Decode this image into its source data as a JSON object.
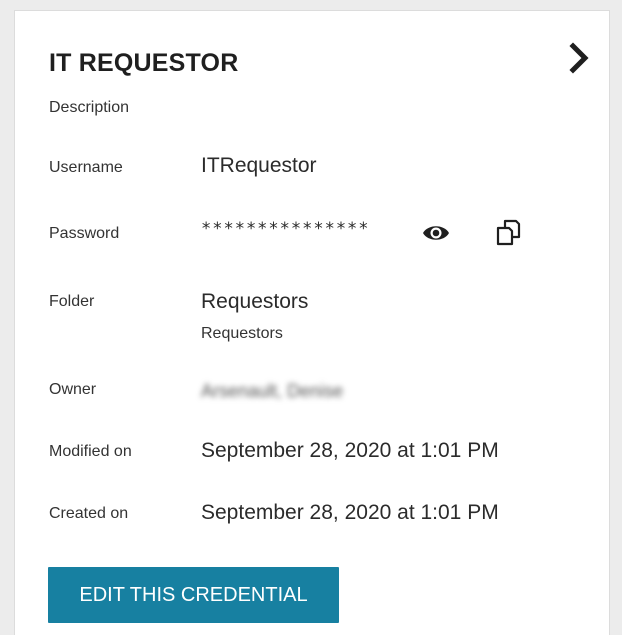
{
  "credential": {
    "title": "IT REQUESTOR",
    "description_label": "Description",
    "username_label": "Username",
    "username_value": "ITRequestor",
    "password_label": "Password",
    "password_value": "***************",
    "folder_label": "Folder",
    "folder_value": "Requestors",
    "folder_path": "Requestors",
    "owner_label": "Owner",
    "owner_value": "Arsenault, Denise",
    "modified_label": "Modified on",
    "modified_value": "September 28, 2020 at 1:01 PM",
    "created_label": "Created on",
    "created_value": "September 28, 2020 at 1:01 PM",
    "edit_button_label": "EDIT THIS CREDENTIAL"
  },
  "icons": {
    "expand": "chevron-right-icon",
    "reveal_password": "eye-icon",
    "copy_password": "copy-icon"
  },
  "colors": {
    "accent": "#1780a1",
    "background": "#ececec",
    "card": "#ffffff",
    "title_text": "#1f1f1f"
  }
}
